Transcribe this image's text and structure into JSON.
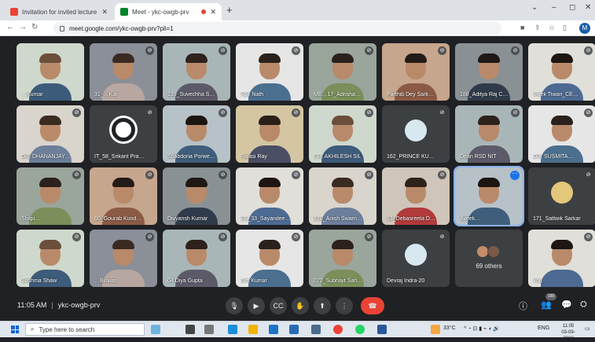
{
  "browser": {
    "tabs": [
      {
        "title": "Invitation for invited lecture - ho",
        "icon": "gmail-icon",
        "active": false
      },
      {
        "title": "Meet - ykc-owgb-prv",
        "icon": "meet-icon",
        "active": true
      }
    ],
    "url": "meet.google.com/ykc-owgb-prv?pli=1",
    "profile_initial": "M",
    "window_controls": [
      "⌄",
      "–",
      "◻",
      "✕"
    ]
  },
  "meet": {
    "participants": [
      {
        "name": "…Kumar",
        "muted": false
      },
      {
        "name": "31_…Kar",
        "muted": true
      },
      {
        "name": "139_Suvechha S…",
        "muted": true
      },
      {
        "name": "Abir Nath",
        "muted": true
      },
      {
        "name": "ME…17_Adrisha…",
        "muted": true
      },
      {
        "name": "Parthib Dey Sark…",
        "muted": true
      },
      {
        "name": "188_Aditya Raj C…",
        "muted": true
      },
      {
        "name": "Vivek Tiwari_CE…",
        "muted": true
      },
      {
        "name": "DR. DHANANJAY…",
        "muted": true
      },
      {
        "name": "IT_58_Srikant Pra…",
        "muted": true
      },
      {
        "name": "Shabdona Porwe…",
        "muted": true
      },
      {
        "name": "Rajasi Ray",
        "muted": true
      },
      {
        "name": "DR. AKHILESH SIL",
        "muted": true
      },
      {
        "name": "162_PRINCE KU…",
        "muted": true
      },
      {
        "name": "Dean RSD NIT",
        "muted": true
      },
      {
        "name": "DR. SUSMITA…",
        "muted": true
      },
      {
        "name": "Shilpi…",
        "muted": true
      },
      {
        "name": "60_Gourab Kund…",
        "muted": true
      },
      {
        "name": "Divyansh Kumar",
        "muted": true
      },
      {
        "name": "EE_33_Sayandee…",
        "muted": true
      },
      {
        "name": "120_Anish Swarn…",
        "muted": true
      },
      {
        "name": "13_Debasreeta D…",
        "muted": true
      },
      {
        "name": "Aveek…",
        "muted": false,
        "speaking": true
      },
      {
        "name": "171_Sattwik Sarkar",
        "muted": true
      },
      {
        "name": "Sushma Shaw",
        "muted": true
      },
      {
        "name": "…Biswas",
        "muted": true
      },
      {
        "name": "04 Diya Gupta",
        "muted": true
      },
      {
        "name": "Om Kumar",
        "muted": true
      },
      {
        "name": "072_Subhajit Sah…",
        "muted": true
      },
      {
        "name": "Devraj Indra-20",
        "muted": true
      },
      {
        "name": "",
        "muted": false,
        "others": true
      },
      {
        "name": "You",
        "muted": true
      }
    ],
    "others_label": "69 others",
    "time": "11:05 AM",
    "meeting_code": "ykc-owgb-prv",
    "participant_count": "100",
    "controls": [
      {
        "name": "mic-button",
        "glyph": "🎙"
      },
      {
        "name": "camera-button",
        "glyph": "▶"
      },
      {
        "name": "captions-button",
        "glyph": "CC"
      },
      {
        "name": "raise-hand-button",
        "glyph": "✋"
      },
      {
        "name": "present-button",
        "glyph": "⬆"
      },
      {
        "name": "more-options-button",
        "glyph": "⋮"
      },
      {
        "name": "end-call-button",
        "glyph": "☎"
      }
    ]
  },
  "taskbar": {
    "search_placeholder": "Type here to search",
    "temperature": "33°C",
    "language": "ENG",
    "clock_time": "11:05",
    "clock_date": "03-09-2022"
  }
}
